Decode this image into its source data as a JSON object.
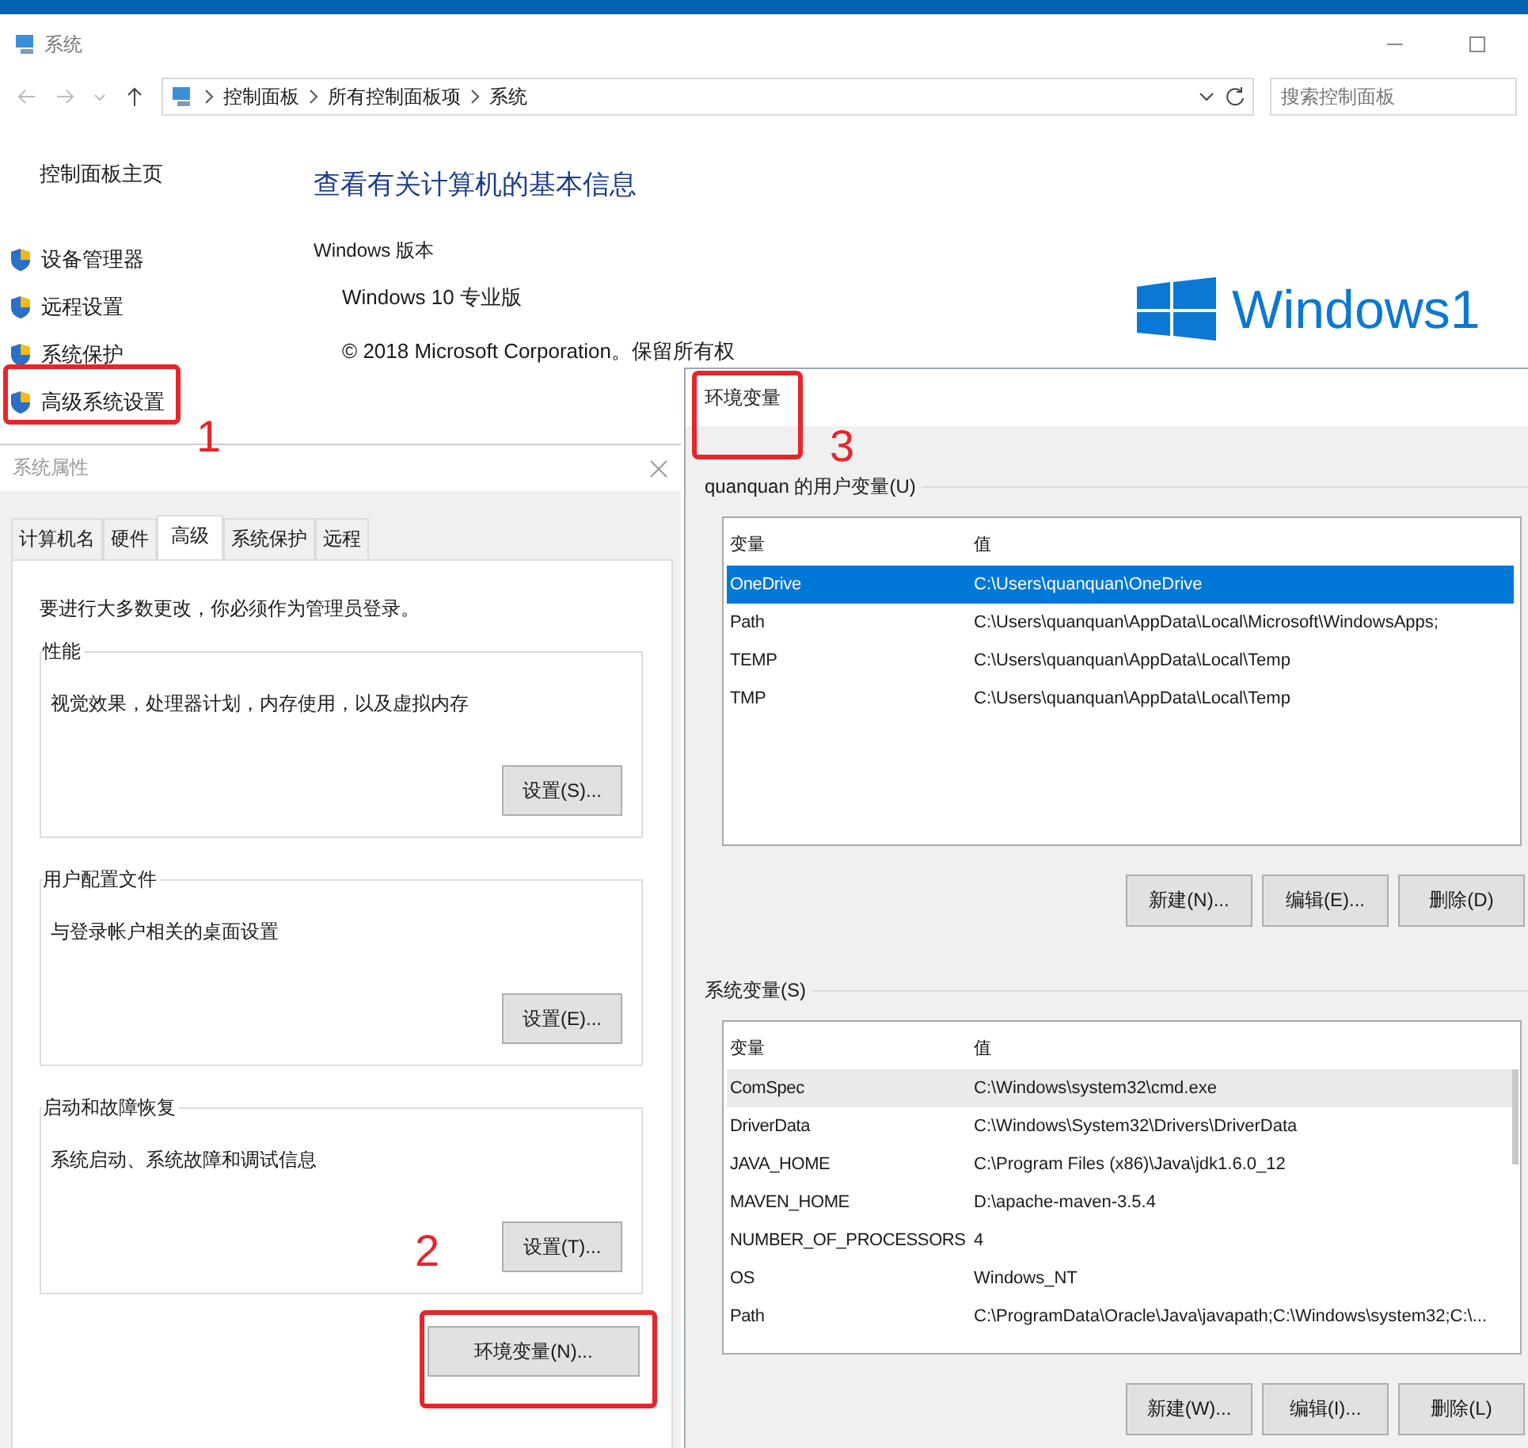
{
  "explorer": {
    "title": "系统",
    "breadcrumb": [
      "控制面板",
      "所有控制面板项",
      "系统"
    ],
    "search": {
      "placeholder": "搜索控制面板"
    },
    "sidebar": {
      "home": "控制面板主页",
      "items": [
        {
          "label": "设备管理器"
        },
        {
          "label": "远程设置"
        },
        {
          "label": "系统保护"
        },
        {
          "label": "高级系统设置"
        }
      ]
    },
    "heading": "查看有关计算机的基本信息",
    "edition": {
      "label": "Windows 版本",
      "name": "Windows 10 专业版",
      "copyright": "© 2018 Microsoft Corporation。保留所有权",
      "logo_text": "Windows1"
    }
  },
  "system_properties": {
    "title": "系统属性",
    "tabs": [
      {
        "label": "计算机名",
        "selected": false
      },
      {
        "label": "硬件",
        "selected": false
      },
      {
        "label": "高级",
        "selected": true
      },
      {
        "label": "系统保护",
        "selected": false
      },
      {
        "label": "远程",
        "selected": false
      }
    ],
    "note": "要进行大多数更改，你必须作为管理员登录。",
    "groups": [
      {
        "title": "性能",
        "description": "视觉效果，处理器计划，内存使用，以及虚拟内存",
        "button": "设置(S)..."
      },
      {
        "title": "用户配置文件",
        "description": "与登录帐户相关的桌面设置",
        "button": "设置(E)..."
      },
      {
        "title": "启动和故障恢复",
        "description": "系统启动、系统故障和调试信息",
        "button": "设置(T)..."
      }
    ],
    "env_button": "环境变量(N)..."
  },
  "env_vars": {
    "title": "环境变量",
    "lists": [
      {
        "title": "quanquan 的用户变量(U)",
        "focused": true,
        "columns": [
          "变量",
          "值"
        ],
        "rows": [
          {
            "name": "OneDrive",
            "value": "C:\\Users\\quanquan\\OneDrive",
            "selected": true
          },
          {
            "name": "Path",
            "value": "C:\\Users\\quanquan\\AppData\\Local\\Microsoft\\WindowsApps;",
            "selected": false
          },
          {
            "name": "TEMP",
            "value": "C:\\Users\\quanquan\\AppData\\Local\\Temp",
            "selected": false
          },
          {
            "name": "TMP",
            "value": "C:\\Users\\quanquan\\AppData\\Local\\Temp",
            "selected": false
          }
        ],
        "buttons": [
          "新建(N)...",
          "编辑(E)...",
          "删除(D)"
        ]
      },
      {
        "title": "系统变量(S)",
        "focused": false,
        "columns": [
          "变量",
          "值"
        ],
        "rows": [
          {
            "name": "ComSpec",
            "value": "C:\\Windows\\system32\\cmd.exe",
            "selected": true
          },
          {
            "name": "DriverData",
            "value": "C:\\Windows\\System32\\Drivers\\DriverData",
            "selected": false
          },
          {
            "name": "JAVA_HOME",
            "value": "C:\\Program Files (x86)\\Java\\jdk1.6.0_12",
            "selected": false
          },
          {
            "name": "MAVEN_HOME",
            "value": "D:\\apache-maven-3.5.4",
            "selected": false
          },
          {
            "name": "NUMBER_OF_PROCESSORS",
            "value": "4",
            "selected": false
          },
          {
            "name": "OS",
            "value": "Windows_NT",
            "selected": false
          },
          {
            "name": "Path",
            "value": "C:\\ProgramData\\Oracle\\Java\\javapath;C:\\Windows\\system32;C:\\...",
            "selected": false
          }
        ],
        "buttons": [
          "新建(W)...",
          "编辑(I)...",
          "删除(L)"
        ]
      }
    ]
  },
  "annotations": [
    {
      "number": "1"
    },
    {
      "number": "2"
    },
    {
      "number": "3"
    }
  ]
}
